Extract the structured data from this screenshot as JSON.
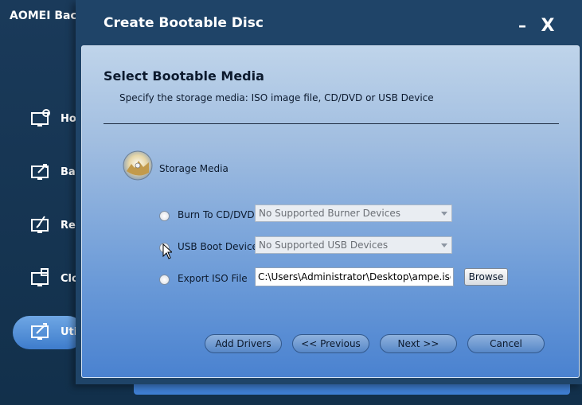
{
  "app": {
    "title": "AOMEI Backupper",
    "sidebar": [
      {
        "label": "Home",
        "icon": "home-monitor-icon"
      },
      {
        "label": "Backup",
        "icon": "backup-monitor-icon"
      },
      {
        "label": "Restore",
        "icon": "restore-monitor-icon"
      },
      {
        "label": "Clone",
        "icon": "clone-monitor-icon"
      },
      {
        "label": "Utilities",
        "icon": "utilities-monitor-icon",
        "active": true
      }
    ]
  },
  "dialog": {
    "title": "Create Bootable Disc",
    "minimize_label": "–",
    "close_label": "X",
    "section_title": "Select Bootable Media",
    "section_desc": "Specify the storage media: ISO image file, CD/DVD or USB Device",
    "storage_label": "Storage Media",
    "options": [
      {
        "label": "Burn To CD/DVD",
        "value": "No Supported Burner Devices",
        "selected": false
      },
      {
        "label": "USB Boot Device",
        "value": "No Supported USB Devices",
        "selected": false
      },
      {
        "label": "Export ISO File",
        "value": "C:\\Users\\Administrator\\Desktop\\ampe.iso",
        "selected": false
      }
    ],
    "browse_label": "Browse",
    "buttons": {
      "add_drivers": "Add Drivers",
      "previous": "<< Previous",
      "next": "Next >>",
      "cancel": "Cancel"
    }
  },
  "colors": {
    "accent": "#3e7ccc",
    "panel_bottom": "#4a82d0",
    "dialog_bg": "#1f4468"
  }
}
